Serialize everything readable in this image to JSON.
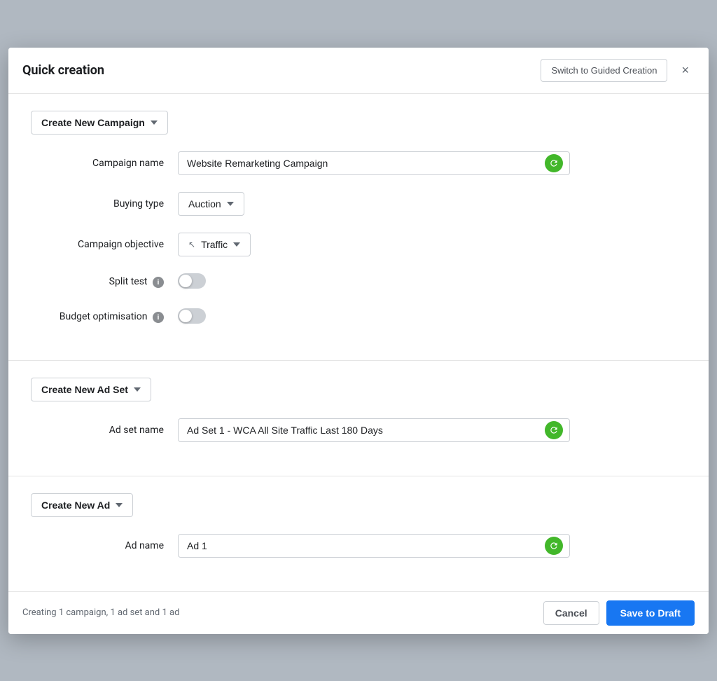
{
  "modal": {
    "title": "Quick creation",
    "switch_guided_label": "Switch to Guided Creation",
    "close_label": "×"
  },
  "campaign_section": {
    "button_label": "Create New Campaign",
    "campaign_name_label": "Campaign name",
    "campaign_name_value": "Website Remarketing Campaign",
    "campaign_name_placeholder": "Campaign name",
    "buying_type_label": "Buying type",
    "buying_type_value": "Auction",
    "campaign_objective_label": "Campaign objective",
    "campaign_objective_value": "Traffic",
    "split_test_label": "Split test",
    "split_test_checked": false,
    "budget_optimisation_label": "Budget optimisation",
    "budget_optimisation_checked": false
  },
  "ad_set_section": {
    "button_label": "Create New Ad Set",
    "ad_set_name_label": "Ad set name",
    "ad_set_name_value": "Ad Set 1 - WCA All Site Traffic Last 180 Days",
    "ad_set_name_placeholder": "Ad set name"
  },
  "ad_section": {
    "button_label": "Create New Ad",
    "ad_name_label": "Ad name",
    "ad_name_value": "Ad 1",
    "ad_name_placeholder": "Ad name"
  },
  "footer": {
    "status_text": "Creating 1 campaign, 1 ad set and 1 ad",
    "cancel_label": "Cancel",
    "save_draft_label": "Save to Draft"
  },
  "icons": {
    "chevron_down": "▾",
    "close": "×",
    "cursor": "↖",
    "info": "i",
    "refresh": "↻"
  }
}
